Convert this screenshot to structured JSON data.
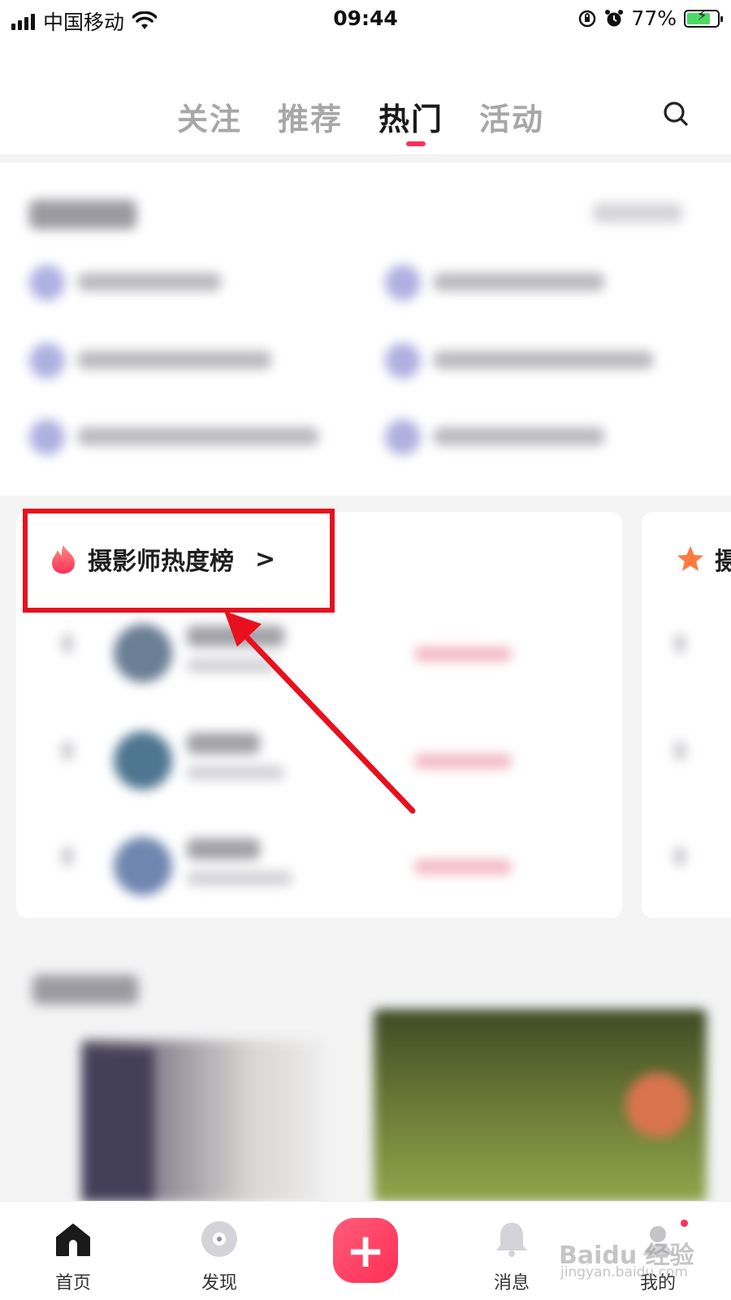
{
  "status_bar": {
    "carrier": "中国移动",
    "time": "09:44",
    "battery_percent": "77%",
    "battery_level": 0.77
  },
  "top_nav": {
    "tabs": [
      {
        "label": "关注",
        "active": false
      },
      {
        "label": "推荐",
        "active": false
      },
      {
        "label": "热门",
        "active": true
      },
      {
        "label": "活动",
        "active": false
      }
    ],
    "search_icon": "search-icon"
  },
  "ranking_card": {
    "title": "摄影师热度榜",
    "icon": "flame-icon",
    "chevron": ">"
  },
  "second_card": {
    "title": "摄",
    "icon": "star-icon"
  },
  "bottom_bar": {
    "items": [
      {
        "label": "首页",
        "icon": "home-icon"
      },
      {
        "label": "发现",
        "icon": "discover-icon"
      },
      {
        "label": "消息",
        "icon": "bell-icon"
      },
      {
        "label": "我的",
        "icon": "profile-icon"
      }
    ],
    "add_icon": "plus-icon",
    "add_symbol": "+"
  },
  "watermark": {
    "brand": "Baidu 经验",
    "url": "jingyan.baidu.com"
  },
  "colors": {
    "accent": "#ff2f5c",
    "annotation": "#e8101e"
  }
}
